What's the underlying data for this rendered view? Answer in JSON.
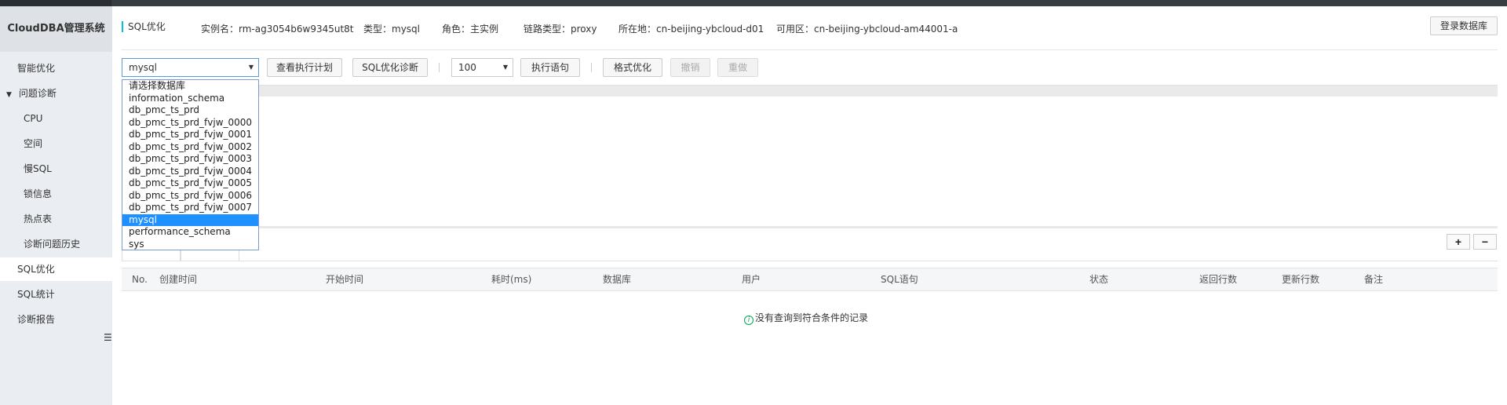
{
  "sidebar": {
    "title": "CloudDBA管理系统",
    "items": [
      {
        "label": "智能优化"
      },
      {
        "label": "问题诊断"
      },
      {
        "label": "CPU"
      },
      {
        "label": "空间"
      },
      {
        "label": "慢SQL"
      },
      {
        "label": "锁信息"
      },
      {
        "label": "热点表"
      },
      {
        "label": "诊断问题历史"
      },
      {
        "label": "SQL优化"
      },
      {
        "label": "SQL统计"
      },
      {
        "label": "诊断报告"
      }
    ],
    "collapse_icon": "menu-collapse-icon"
  },
  "header": {
    "title": "SQL优化",
    "instance": "实例名：rm-ag3054b6w9345ut8t",
    "type": "类型：mysql",
    "role": "角色：主实例",
    "link_type": "链路类型：proxy",
    "location": "所在地：cn-beijing-ybcloud-d01",
    "zone": "可用区：cn-beijing-ybcloud-am44001-a",
    "login_button": "登录数据库"
  },
  "toolbar": {
    "database_select": "mysql",
    "explain_button": "查看执行计划",
    "diagnose_button": "SQL优化诊断",
    "limit_select": "100",
    "execute_button": "执行语句",
    "format_button": "格式优化",
    "undo_button": "撤销",
    "redo_button": "重做"
  },
  "dropdown": {
    "options": [
      "请选择数据库",
      "information_schema",
      "db_pmc_ts_prd",
      "db_pmc_ts_prd_fvjw_0000",
      "db_pmc_ts_prd_fvjw_0001",
      "db_pmc_ts_prd_fvjw_0002",
      "db_pmc_ts_prd_fvjw_0003",
      "db_pmc_ts_prd_fvjw_0004",
      "db_pmc_ts_prd_fvjw_0005",
      "db_pmc_ts_prd_fvjw_0006",
      "db_pmc_ts_prd_fvjw_0007",
      "mysql",
      "performance_schema",
      "sys"
    ],
    "selected_index": 11
  },
  "result": {
    "add_button": "+",
    "remove_button": "−",
    "columns": [
      "No.",
      "创建时间",
      "开始时间",
      "耗时(ms)",
      "数据库",
      "用户",
      "SQL语句",
      "状态",
      "返回行数",
      "更新行数",
      "备注"
    ],
    "empty_text": "没有查询到符合条件的记录"
  },
  "colors": {
    "accent": "#00c1de",
    "selection": "#1e90ff",
    "sidebar_bg": "#eaedf1"
  }
}
